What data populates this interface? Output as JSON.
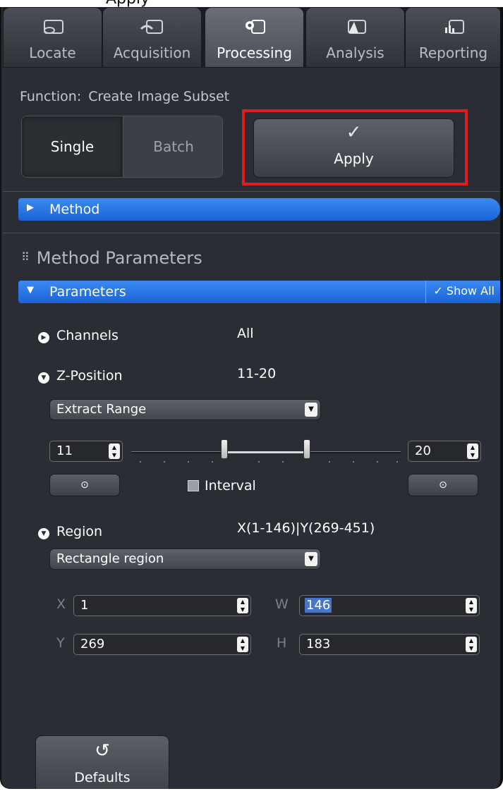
{
  "window_title_fragment": "Apply",
  "tabs": [
    {
      "label": "Locate",
      "icon": "locate-icon"
    },
    {
      "label": "Acquisition",
      "icon": "acquisition-icon"
    },
    {
      "label": "Processing",
      "icon": "processing-icon",
      "active": true
    },
    {
      "label": "Analysis",
      "icon": "analysis-icon"
    },
    {
      "label": "Reporting",
      "icon": "reporting-icon"
    }
  ],
  "function": {
    "label": "Function:",
    "value": "Create Image Subset"
  },
  "mode": {
    "single": "Single",
    "batch": "Batch",
    "selected": "Single"
  },
  "apply": {
    "label": "Apply",
    "icon": "checkmark-icon",
    "highlight_color": "#e21b1b"
  },
  "method_bar": {
    "label": "Method"
  },
  "method_parameters_title": "Method Parameters",
  "parameters_bar": {
    "label": "Parameters",
    "show_all": "Show All"
  },
  "channels": {
    "label": "Channels",
    "value": "All"
  },
  "z_position": {
    "label": "Z-Position",
    "value": "11-20",
    "mode": "Extract Range",
    "start": "11",
    "end": "20",
    "interval_label": "Interval",
    "interval_checked": false
  },
  "region": {
    "label": "Region",
    "value": "X(1-146)|Y(269-451)",
    "mode": "Rectangle region",
    "x_label": "X",
    "x": "1",
    "y_label": "Y",
    "y": "269",
    "w_label": "W",
    "w": "146",
    "h_label": "H",
    "h": "183"
  },
  "defaults": {
    "label": "Defaults",
    "icon": "reset-icon"
  },
  "colors": {
    "accent_blue": "#2f7bea",
    "panel": "#2a2d33",
    "highlight_red": "#e21b1b"
  }
}
